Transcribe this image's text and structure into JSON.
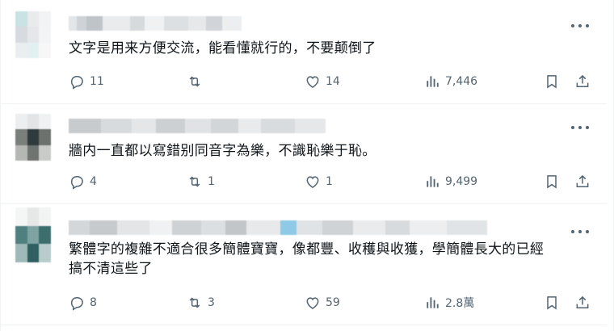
{
  "posts": [
    {
      "text_lines": [
        "文字是用来方便交流，能看懂就行的，不要颠倒了"
      ],
      "replies": "11",
      "reposts": "",
      "likes": "14",
      "views": "7,446",
      "more_icon": "more-horizontal-icon"
    },
    {
      "text_lines": [
        "牆内一直都以寫錯别同音字為樂，不識恥樂于恥。"
      ],
      "replies": "4",
      "reposts": "1",
      "likes": "1",
      "views": "9,499",
      "more_icon": "more-horizontal-icon"
    },
    {
      "text_lines": [
        "繁體字的複雜不適合很多簡體寶寶，像都豐、收穫與收獲，學簡體長大的已經",
        "搞不清這些了"
      ],
      "replies": "8",
      "reposts": "3",
      "likes": "59",
      "views": "2.8萬",
      "more_icon": "more-horizontal-icon"
    }
  ],
  "icons": {
    "reply": "reply-icon",
    "repost": "repost-icon",
    "like": "heart-icon",
    "views": "analytics-icon",
    "bookmark": "bookmark-icon",
    "share": "share-icon"
  },
  "colors": {
    "text": "#0f1419",
    "secondary": "#536471",
    "divider": "#eff3f4"
  }
}
